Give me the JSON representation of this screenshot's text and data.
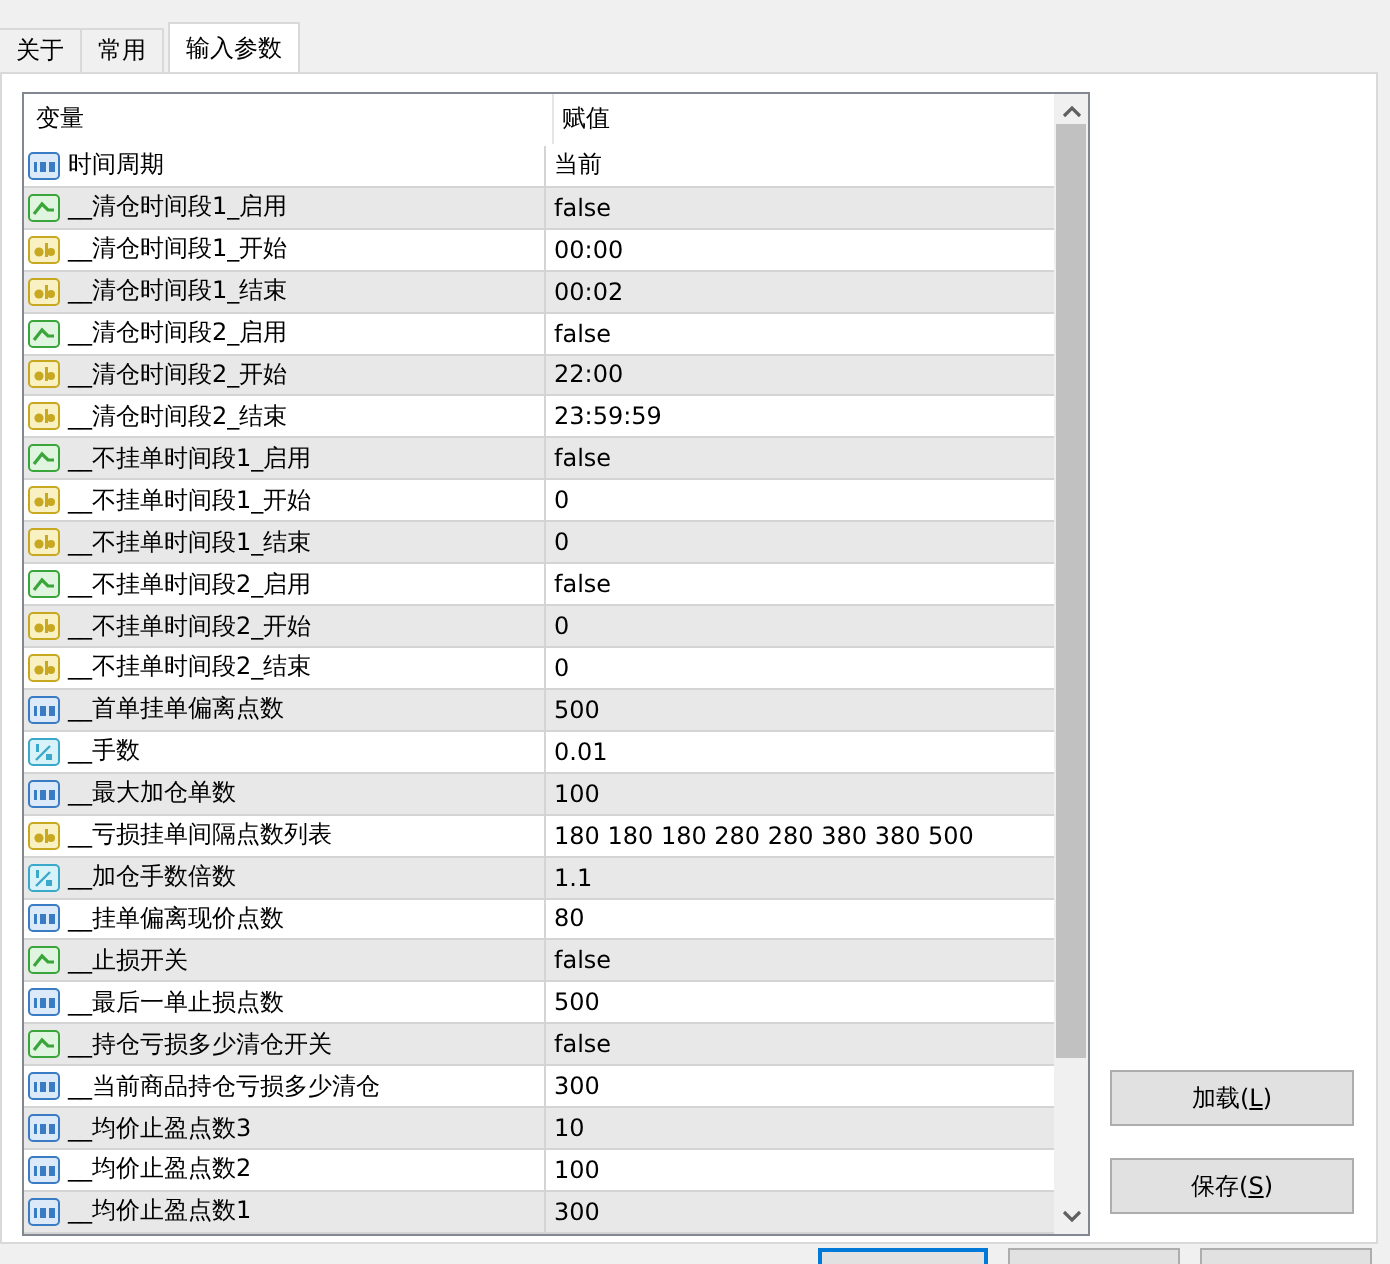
{
  "tabs": [
    {
      "label": "关于",
      "selected": false
    },
    {
      "label": "常用",
      "selected": false
    },
    {
      "label": "输入参数",
      "selected": true
    }
  ],
  "table": {
    "columns": [
      "变量",
      "赋值"
    ],
    "rows": [
      {
        "kind": "int",
        "name": "时间周期",
        "value": "当前"
      },
      {
        "kind": "bool",
        "name": "__清仓时间段1_启用",
        "value": "false"
      },
      {
        "kind": "string",
        "name": "__清仓时间段1_开始",
        "value": "00:00"
      },
      {
        "kind": "string",
        "name": "__清仓时间段1_结束",
        "value": "00:02"
      },
      {
        "kind": "bool",
        "name": "__清仓时间段2_启用",
        "value": "false"
      },
      {
        "kind": "string",
        "name": "__清仓时间段2_开始",
        "value": "22:00"
      },
      {
        "kind": "string",
        "name": "__清仓时间段2_结束",
        "value": "23:59:59"
      },
      {
        "kind": "bool",
        "name": "__不挂单时间段1_启用",
        "value": "false"
      },
      {
        "kind": "string",
        "name": "__不挂单时间段1_开始",
        "value": "0"
      },
      {
        "kind": "string",
        "name": "__不挂单时间段1_结束",
        "value": "0"
      },
      {
        "kind": "bool",
        "name": "__不挂单时间段2_启用",
        "value": "false"
      },
      {
        "kind": "string",
        "name": "__不挂单时间段2_开始",
        "value": "0"
      },
      {
        "kind": "string",
        "name": "__不挂单时间段2_结束",
        "value": "0"
      },
      {
        "kind": "int",
        "name": "__首单挂单偏离点数",
        "value": "500"
      },
      {
        "kind": "double",
        "name": "__手数",
        "value": "0.01"
      },
      {
        "kind": "int",
        "name": "__最大加仓单数",
        "value": "100"
      },
      {
        "kind": "string",
        "name": "__亏损挂单间隔点数列表",
        "value": "180 180 180 280 280 380 380 500"
      },
      {
        "kind": "double",
        "name": "__加仓手数倍数",
        "value": "1.1"
      },
      {
        "kind": "int",
        "name": "__挂单偏离现价点数",
        "value": "80"
      },
      {
        "kind": "bool",
        "name": "__止损开关",
        "value": "false"
      },
      {
        "kind": "int",
        "name": "__最后一单止损点数",
        "value": "500"
      },
      {
        "kind": "bool",
        "name": "__持仓亏损多少清仓开关",
        "value": "false"
      },
      {
        "kind": "int",
        "name": "__当前商品持仓亏损多少清仓",
        "value": "300"
      },
      {
        "kind": "int",
        "name": "__均价止盈点数3",
        "value": "10"
      },
      {
        "kind": "int",
        "name": "__均价止盈点数2",
        "value": "100"
      },
      {
        "kind": "int",
        "name": "__均价止盈点数1",
        "value": "300"
      }
    ]
  },
  "side_buttons": [
    {
      "label": "加载(",
      "hotkey": "L",
      "after": ")"
    },
    {
      "label": "保存(",
      "hotkey": "S",
      "after": ")"
    }
  ],
  "bottom_buttons": [
    {
      "selected": true
    },
    {
      "selected": false
    },
    {
      "selected": false
    }
  ]
}
